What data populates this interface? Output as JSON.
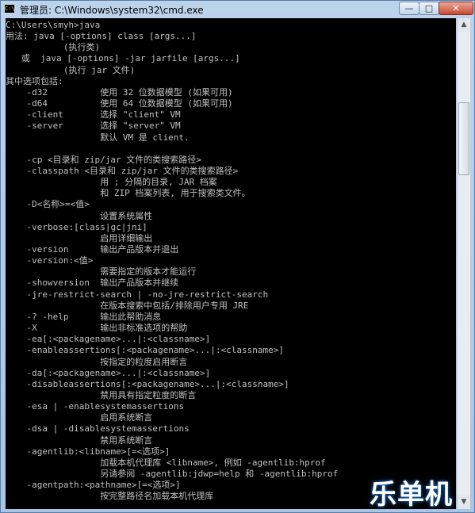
{
  "window": {
    "title": "管理员: C:\\Windows\\system32\\cmd.exe",
    "icon_label": "C:\\",
    "controls": {
      "minimize": "—",
      "maximize": "□",
      "close": "✕"
    }
  },
  "console": {
    "lines": [
      "C:\\Users\\smyh>java",
      "用法: java [-options] class [args...]",
      "           (执行类)",
      "   或  java [-options] -jar jarfile [args...]",
      "           (执行 jar 文件)",
      "其中选项包括:",
      "    -d32          使用 32 位数据模型 (如果可用)",
      "    -d64          使用 64 位数据模型 (如果可用)",
      "    -client       选择 \"client\" VM",
      "    -server       选择 \"server\" VM",
      "                  默认 VM 是 client.",
      "",
      "    -cp <目录和 zip/jar 文件的类搜索路径>",
      "    -classpath <目录和 zip/jar 文件的类搜索路径>",
      "                  用 ; 分隔的目录, JAR 档案",
      "                  和 ZIP 档案列表, 用于搜索类文件。",
      "    -D<名称>=<值>",
      "                  设置系统属性",
      "    -verbose:[class|gc|jni]",
      "                  启用详细输出",
      "    -version      输出产品版本并退出",
      "    -version:<值>",
      "                  需要指定的版本才能运行",
      "    -showversion  输出产品版本并继续",
      "    -jre-restrict-search | -no-jre-restrict-search",
      "                  在版本搜索中包括/排除用户专用 JRE",
      "    -? -help      输出此帮助消息",
      "    -X            输出非标准选项的帮助",
      "    -ea[:<packagename>...|:<classname>]",
      "    -enableassertions[:<packagename>...|:<classname>]",
      "                  按指定的粒度启用断言",
      "    -da[:<packagename>...|:<classname>]",
      "    -disableassertions[:<packagename>...|:<classname>]",
      "                  禁用具有指定粒度的断言",
      "    -esa | -enablesystemassertions",
      "                  启用系统断言",
      "    -dsa | -disablesystemassertions",
      "                  禁用系统断言",
      "    -agentlib:<libname>[=<选项>]",
      "                  加载本机代理库 <libname>, 例如 -agentlib:hprof",
      "                  另请参阅 -agentlib:jdwp=help 和 -agentlib:hprof",
      "    -agentpath:<pathname>[=<选项>]",
      "                  按完整路径名加载本机代理库"
    ]
  },
  "scrollbar": {
    "up": "▲",
    "down": "▼",
    "position": 0.18
  },
  "watermark": "乐单机",
  "colors": {
    "console_bg": "#000000",
    "console_text": "#c0c0c0",
    "titlebar": "#bcd3ec",
    "close": "#c74a35"
  }
}
